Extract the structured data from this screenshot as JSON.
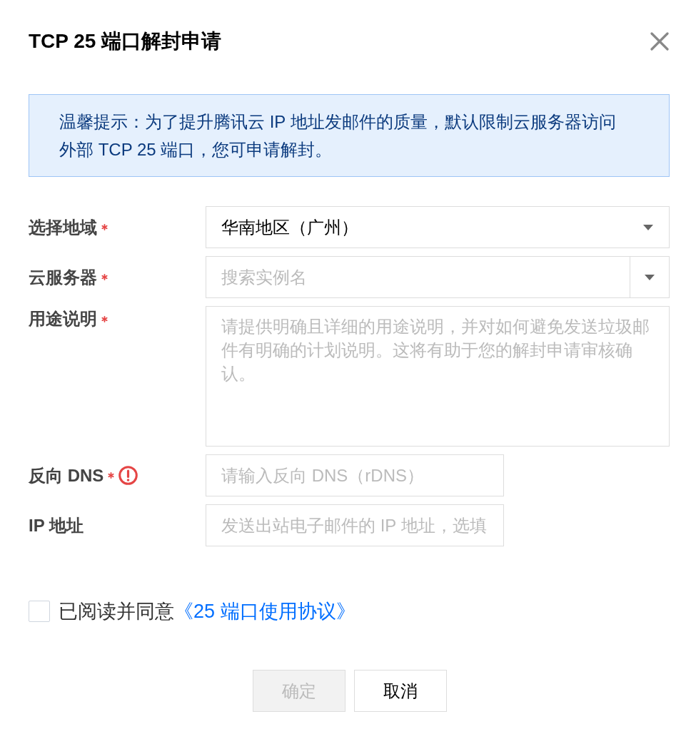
{
  "dialog": {
    "title": "TCP 25 端口解封申请"
  },
  "notice": {
    "text": "温馨提示：为了提升腾讯云 IP 地址发邮件的质量，默认限制云服务器访问外部 TCP 25 端口，您可申请解封。"
  },
  "fields": [
    {
      "kind": "select",
      "label": "选择地域",
      "required": true,
      "error": false,
      "value": "华南地区（广州）"
    },
    {
      "kind": "search_select",
      "label": "云服务器",
      "required": true,
      "error": false,
      "placeholder": "搜索实例名"
    },
    {
      "kind": "textarea",
      "label": "用途说明",
      "required": true,
      "error": false,
      "placeholder": "请提供明确且详细的用途说明，并对如何避免发送垃圾邮件有明确的计划说明。这将有助于您的解封申请审核确认。"
    },
    {
      "kind": "input",
      "label": "反向 DNS",
      "required": true,
      "error": true,
      "placeholder": "请输入反向 DNS（rDNS）"
    },
    {
      "kind": "input",
      "label": "IP 地址",
      "required": false,
      "error": false,
      "placeholder": "发送出站电子邮件的 IP 地址，选填"
    }
  ],
  "agreement": {
    "checked": false,
    "text": "已阅读并同意",
    "link": "《25 端口使用协议》"
  },
  "buttons": [
    {
      "label": "确定",
      "disabled": true
    },
    {
      "label": "取消",
      "disabled": false
    }
  ]
}
